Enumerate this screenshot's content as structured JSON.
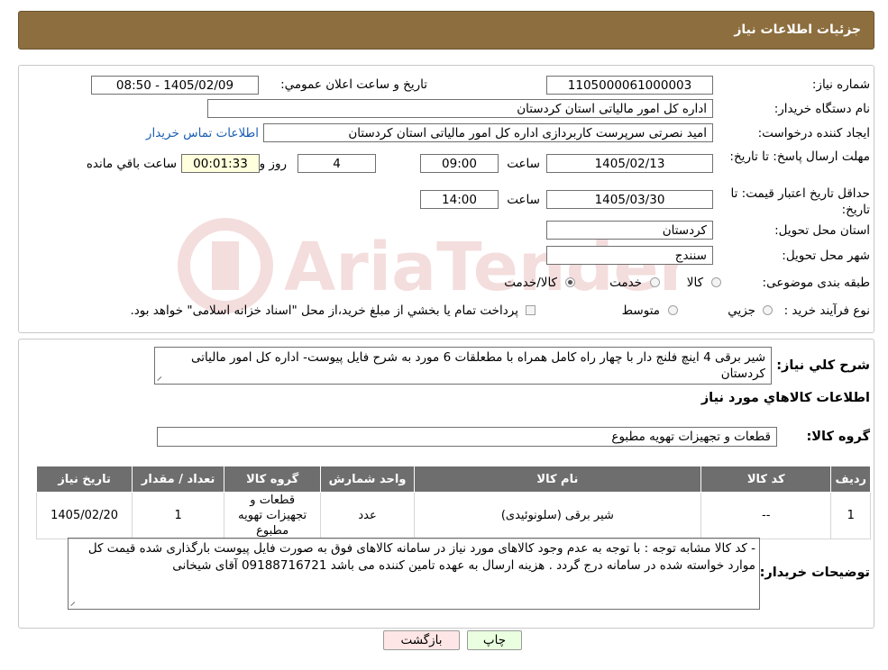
{
  "header": {
    "title": "جزئیات اطلاعات نیاز"
  },
  "fields": {
    "need_number_label": "شماره نیاز:",
    "need_number": "1105000061000003",
    "announce_label": "تاریخ و ساعت اعلان عمومي:",
    "announce_value": "1405/02/09 - 08:50",
    "buyer_org_label": "نام دستگاه خريدار:",
    "buyer_org": "اداره کل امور مالیاتی استان کردستان",
    "creator_label": "ایجاد کننده درخواست:",
    "creator": "امید نصرتی سرپرست کاربردازی اداره کل امور مالیاتی استان کردستان",
    "contact_link": "اطلاعات تماس خريدار",
    "deadline_label": "مهلت ارسال پاسخ: تا تاریخ:",
    "deadline_date": "1405/02/13",
    "time_label": "ساعت",
    "deadline_time": "09:00",
    "days_value": "4",
    "days_label": "روز و",
    "remaining_time": "00:01:33",
    "remaining_label": "ساعت باقي مانده",
    "price_validity_label": "حداقل تاريخ اعتبار قيمت: تا تاریخ:",
    "price_validity_date": "1405/03/30",
    "price_validity_time": "14:00",
    "province_label": "استان محل تحويل:",
    "province": "کردستان",
    "city_label": "شهر محل تحويل:",
    "city": "سنندج",
    "category_label": "طبقه بندی موضوعی:",
    "category_options": [
      "کالا",
      "خدمت",
      "کالا/خدمت"
    ],
    "category_selected": "کالا/خدمت",
    "process_label": "نوع فرآیند خرید :",
    "process_options": [
      "جزيي",
      "متوسط"
    ],
    "process_note": "پرداخت تمام يا بخشي از مبلغ خريد،از محل \"اسناد خزانه اسلامی\" خواهد بود."
  },
  "description": {
    "label": "شرح کلي نياز:",
    "text": "شیر برقی 4 اینچ فلنج دار با چهار راه کامل همراه با مطعلقات 6 مورد به شرح فایل پیوست- اداره کل امور مالیاتی کردستان"
  },
  "goods_section": {
    "title": "اطلاعات کالاهاي مورد نياز",
    "group_label": "گروه کالا:",
    "group_value": "قطعات و تجهیزات تهویه مطبوع"
  },
  "table": {
    "headers": [
      "رديف",
      "کد کالا",
      "نام کالا",
      "واحد شمارش",
      "گروه کالا",
      "تعداد / مقدار",
      "تاريخ نياز"
    ],
    "rows": [
      [
        "1",
        "--",
        "شیر برقی (سلونوئیدی)",
        "عدد",
        "قطعات و تجهیزات تهویه مطبوع",
        "1",
        "1405/02/20"
      ]
    ]
  },
  "buyer_notes": {
    "label": "توضيحات خريدار:",
    "text": "- کد کالا مشابه  توجه : با توجه به عدم وجود کالاهای مورد نیاز در سامانه  کالاهای فوق به صورت فایل پیوست بارگذاری شده قیمت کل موارد خواسته شده در سامانه درج گردد . هزینه ارسال به عهده تامین کننده می باشد 09188716721 آقای شیخانی"
  },
  "buttons": {
    "print": "چاپ",
    "back": "بازگشت"
  },
  "colors": {
    "header_bg": "#8d6e3f",
    "table_header_bg": "#6e6e6e",
    "print_bg": "#eaffe0",
    "back_bg": "#ffe6e6"
  }
}
